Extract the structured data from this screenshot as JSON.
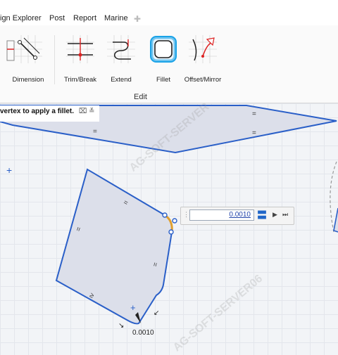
{
  "menu": {
    "items": [
      "ign Explorer",
      "Post",
      "Report",
      "Marine"
    ]
  },
  "ribbon": {
    "tools": [
      {
        "label": "Dimension",
        "icon": "dimension-icon"
      },
      {
        "label": "Trim/Break",
        "icon": "trim-break-icon"
      },
      {
        "label": "Extend",
        "icon": "extend-icon"
      },
      {
        "label": "Fillet",
        "icon": "fillet-icon"
      },
      {
        "label": "Offset/Mirror",
        "icon": "offset-mirror-icon"
      }
    ],
    "group_label": "Edit"
  },
  "prompt": {
    "text": "vertex to apply a fillet.",
    "icons": "⌧ ≚"
  },
  "fillet_input": {
    "value": "0.0010"
  },
  "dimension_label": "0.0010",
  "colors": {
    "shape_fill": "#dcdfea",
    "shape_stroke": "#2a5fc8",
    "highlight": "#e0a030",
    "accent": "#1aa3e8"
  }
}
